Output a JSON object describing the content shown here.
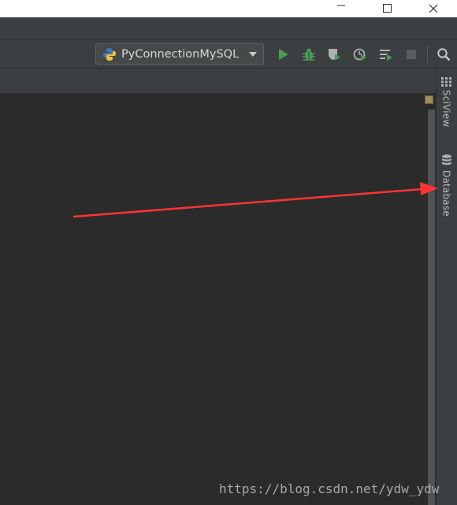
{
  "run_config": {
    "label": "PyConnectionMySQL",
    "icon": "python-icon"
  },
  "toolbar": {
    "run_icon": "run-icon",
    "debug_icon": "debug-icon",
    "coverage_icon": "coverage-icon",
    "profile_icon": "profile-icon",
    "concurrency_icon": "concurrency-icon",
    "stop_icon": "stop-icon",
    "search_icon": "search-icon"
  },
  "right_sidebar": {
    "tabs": [
      {
        "label": "SciView",
        "icon": "sciview-icon"
      },
      {
        "label": "Database",
        "icon": "database-icon"
      }
    ]
  },
  "watermark": "https://blog.csdn.net/ydw_ydw",
  "colors": {
    "editor_bg": "#2b2b2b",
    "panel_bg": "#3c3f41",
    "run_green": "#499c54",
    "arrow_red": "#ff3333"
  }
}
